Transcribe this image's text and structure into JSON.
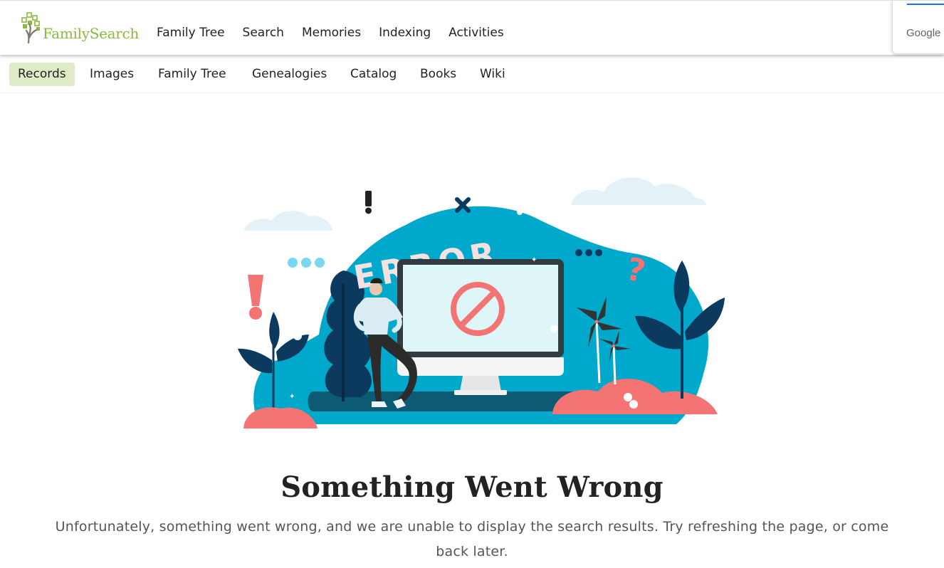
{
  "header": {
    "brand": "FamilySearch",
    "primary_nav": [
      "Family Tree",
      "Search",
      "Memories",
      "Indexing",
      "Activities"
    ]
  },
  "google_widget": {
    "label": "Google"
  },
  "sub_nav": {
    "tabs": [
      "Records",
      "Images",
      "Family Tree",
      "Genealogies",
      "Catalog",
      "Books",
      "Wiki"
    ],
    "active": "Records"
  },
  "illustration": {
    "word": "ERROR"
  },
  "error": {
    "title": "Something Went Wrong",
    "message": "Unfortunately, something went wrong, and we are unable to display the search results. Try refreshing the page, or come back later."
  },
  "colors": {
    "brand_green": "#8cb83f",
    "active_tab_bg": "#dfeac7",
    "illustration_teal": "#00a9cc",
    "illustration_navy": "#0b3a5e",
    "illustration_coral": "#f47474"
  },
  "icons": [
    "family-tree-logo-icon",
    "prohibited-icon",
    "exclamation-icon",
    "question-mark-icon",
    "x-mark-icon"
  ]
}
